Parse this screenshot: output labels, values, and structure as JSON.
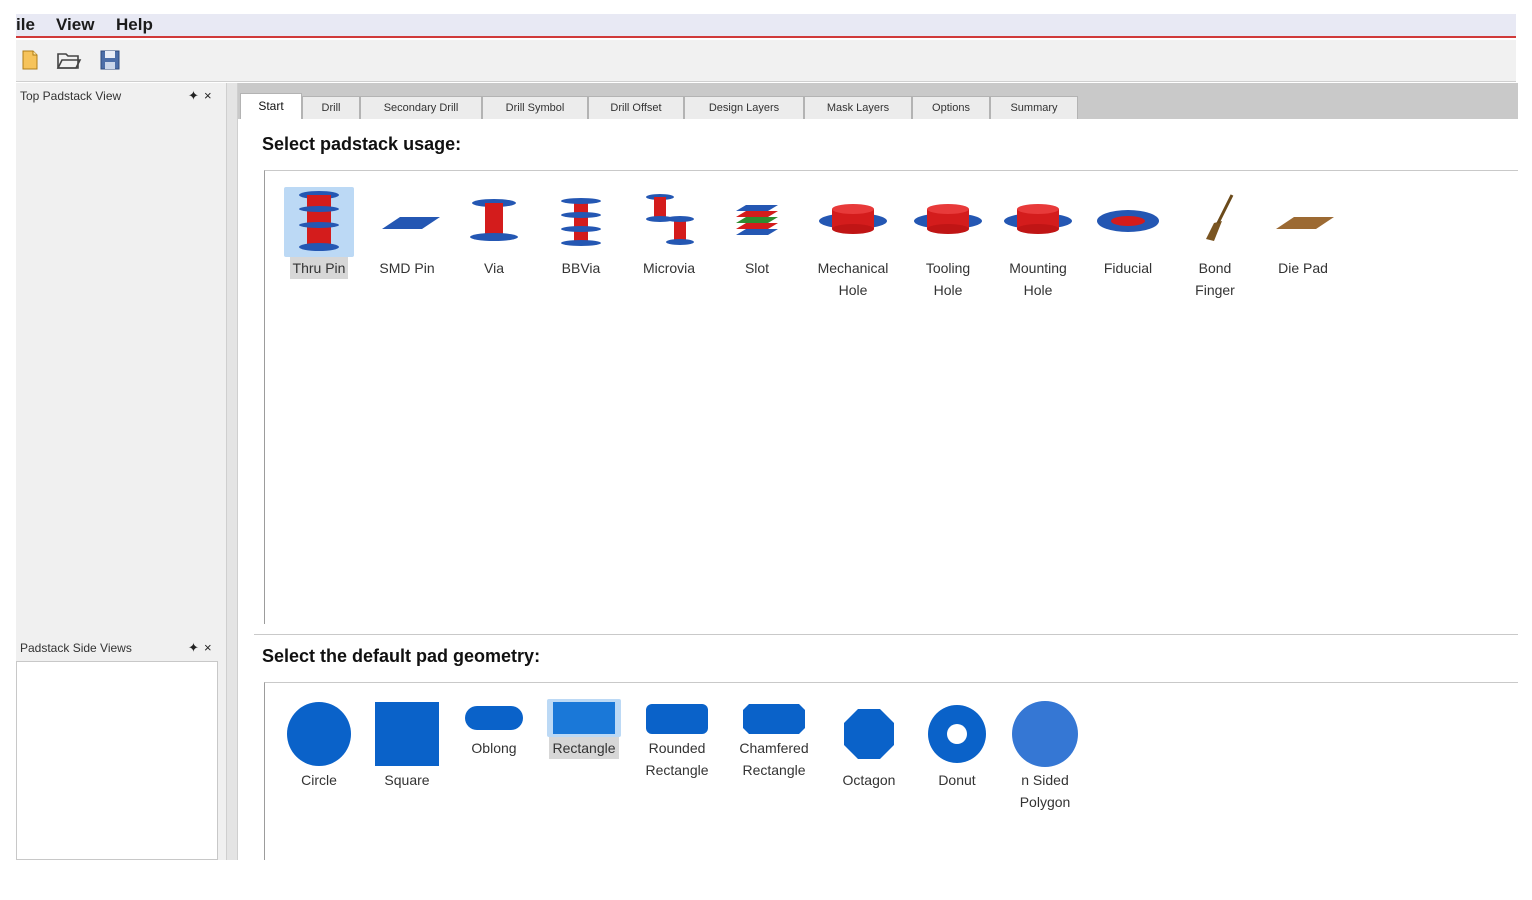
{
  "menu": {
    "file": "ile",
    "view": "View",
    "help": "Help"
  },
  "toolbar": {
    "new_icon": "new-file-icon",
    "open_icon": "folder-open-icon",
    "save_icon": "save-icon"
  },
  "dock": {
    "top_view_title": "Top Padstack View",
    "side_view_title": "Padstack Side Views",
    "pin_glyph": "✦",
    "close_glyph": "×"
  },
  "tabs": [
    "Start",
    "Drill",
    "Secondary Drill",
    "Drill Symbol",
    "Drill Offset",
    "Design Layers",
    "Mask Layers",
    "Options",
    "Summary"
  ],
  "usage": {
    "title": "Select padstack usage:",
    "items": [
      {
        "name": "Thru Pin",
        "line2": "",
        "icon": "thru-pin-icon"
      },
      {
        "name": "SMD Pin",
        "line2": "",
        "icon": "smd-pin-icon"
      },
      {
        "name": "Via",
        "line2": "",
        "icon": "via-icon"
      },
      {
        "name": "BBVia",
        "line2": "",
        "icon": "bbvia-icon"
      },
      {
        "name": "Microvia",
        "line2": "",
        "icon": "microvia-icon"
      },
      {
        "name": "Slot",
        "line2": "",
        "icon": "slot-icon"
      },
      {
        "name": "Mechanical",
        "line2": "Hole",
        "icon": "mechanical-hole-icon"
      },
      {
        "name": "Tooling",
        "line2": "Hole",
        "icon": "tooling-hole-icon"
      },
      {
        "name": "Mounting",
        "line2": "Hole",
        "icon": "mounting-hole-icon"
      },
      {
        "name": "Fiducial",
        "line2": "",
        "icon": "fiducial-icon"
      },
      {
        "name": "Bond",
        "line2": "Finger",
        "icon": "bond-finger-icon"
      },
      {
        "name": "Die Pad",
        "line2": "",
        "icon": "die-pad-icon"
      }
    ],
    "selected": "Thru Pin"
  },
  "geometry": {
    "title": "Select the default pad geometry:",
    "items": [
      {
        "name": "Circle",
        "line2": "",
        "icon": "circle-shape-icon"
      },
      {
        "name": "Square",
        "line2": "",
        "icon": "square-shape-icon"
      },
      {
        "name": "Oblong",
        "line2": "",
        "icon": "oblong-shape-icon"
      },
      {
        "name": "Rectangle",
        "line2": "",
        "icon": "rectangle-shape-icon"
      },
      {
        "name": "Rounded",
        "line2": "Rectangle",
        "icon": "rounded-rectangle-icon"
      },
      {
        "name": "Chamfered",
        "line2": "Rectangle",
        "icon": "chamfered-rectangle-icon"
      },
      {
        "name": "Octagon",
        "line2": "",
        "icon": "octagon-shape-icon"
      },
      {
        "name": "Donut",
        "line2": "",
        "icon": "donut-shape-icon"
      },
      {
        "name": "n Sided",
        "line2": "Polygon",
        "icon": "n-sided-polygon-icon"
      }
    ],
    "selected": "Rectangle"
  },
  "colors": {
    "copper": "#d41c1c",
    "pad_blue": "#2457b3",
    "shape_blue": "#0a62c9",
    "accent_red": "#d03a3a"
  }
}
